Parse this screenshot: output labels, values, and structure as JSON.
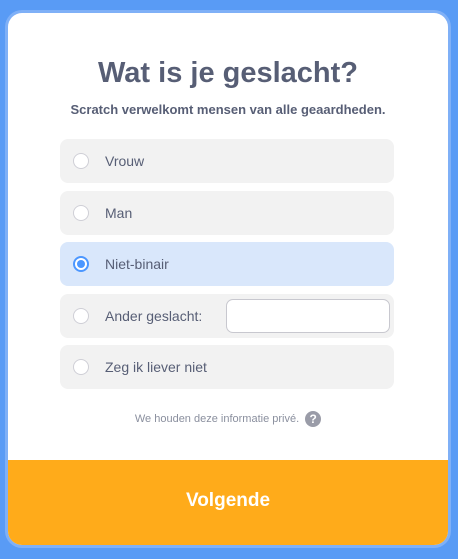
{
  "dialog": {
    "title": "Wat is je geslacht?",
    "subtitle": "Scratch verwelkomt mensen van alle geaardheden.",
    "options": [
      {
        "label": "Vrouw",
        "selected": false
      },
      {
        "label": "Man",
        "selected": false
      },
      {
        "label": "Niet-binair",
        "selected": true
      },
      {
        "label": "Ander geslacht:",
        "selected": false,
        "has_text_input": true,
        "input_value": ""
      },
      {
        "label": "Zeg ik liever niet",
        "selected": false
      }
    ],
    "privacy_note": "We houden deze informatie privé.",
    "help_icon_glyph": "?",
    "next_button": "Volgende"
  },
  "colors": {
    "background": "#4c97ff",
    "accent": "#4c97ff",
    "button": "#ffab1a",
    "text": "#575e75",
    "selected_option": "#d9e7fb"
  }
}
